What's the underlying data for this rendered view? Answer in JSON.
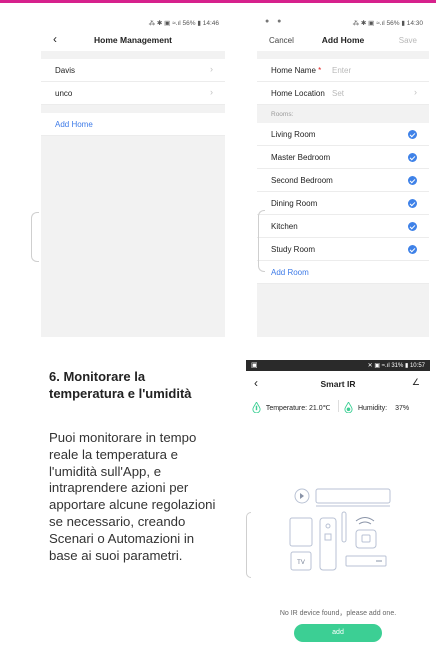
{
  "home_mgmt": {
    "status_text": "⁂ ✱ ▣ ≈.ıl 56% ▮ 14:46",
    "back": "‹",
    "title": "Home Management",
    "homes": [
      "Davis",
      "unco"
    ],
    "chevron": "›",
    "add_home": "Add Home"
  },
  "add_home": {
    "status_left": "● ●",
    "status_text": "⁂ ✱ ▣ ≈.ıl 56% ▮ 14:30",
    "cancel": "Cancel",
    "title": "Add Home",
    "save": "Save",
    "home_name_label": "Home Name",
    "required_mark": "*",
    "home_name_placeholder": "Enter",
    "home_location_label": "Home Location",
    "home_location_value": "Set",
    "chevron": "›",
    "rooms_header": "Rooms:",
    "rooms": [
      "Living Room",
      "Master Bedroom",
      "Second Bedroom",
      "Dining Room",
      "Kitchen",
      "Study Room"
    ],
    "add_room": "Add Room"
  },
  "article": {
    "heading": "6. Monitorare la temperatura e l'umidità",
    "body": "Puoi monitorare in tempo reale la temperatura e l'umidità sull'App, e intraprendere azioni per apportare alcune regolazioni se necessario, creando Scenari o Automazioni in base ai suoi parametri."
  },
  "smart_ir": {
    "status_icon": "▣",
    "status_text": "✕ ▣ ≈.ıl 31% ▮ 10:57",
    "back": "‹",
    "title": "Smart IR",
    "edit": "∠",
    "temperature_label": "Temperature:",
    "temperature_value": "21.0℃",
    "humidity_label": "Humidity:",
    "humidity_value": "37%",
    "tv_label": "TV",
    "empty_message": "No IR device found，please add one.",
    "add_button": "add"
  },
  "colors": {
    "accent_pink": "#d6218c",
    "link_blue": "#3e7be8",
    "check_blue": "#3f82e8",
    "add_green": "#3ccf94",
    "drop_green": "#3ccf94"
  }
}
